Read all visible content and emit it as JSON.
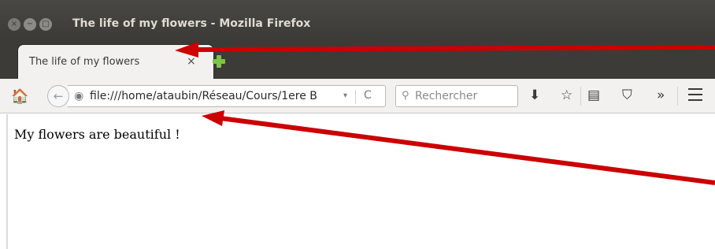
{
  "window": {
    "title": "The life of my flowers - Mozilla Firefox",
    "close_glyph": "×",
    "minimize_glyph": "−",
    "maximize_glyph": "□"
  },
  "tabs": [
    {
      "label": "The life of my flowers",
      "close_glyph": "×",
      "active": true
    }
  ],
  "navbar": {
    "home_glyph": "🏠",
    "back_glyph": "←",
    "site_icon_glyph": "◉",
    "url": "file:///home/ataubin/Réseau/Cours/1ere B",
    "dropdown_glyph": "▾",
    "reload_glyph": "C",
    "search_placeholder": "Rechercher",
    "search_icon_glyph": "⚲",
    "download_glyph": "⬇",
    "bookmark_glyph": "☆",
    "reading_list_glyph": "▤",
    "pocket_glyph": "⛉",
    "overflow_glyph": "»"
  },
  "page": {
    "text": "My flowers are beautiful !"
  },
  "colors": {
    "titlebar": "#3c3b37",
    "tab_background": "#f2f1f0",
    "newtab_plus": "#7ec447",
    "annotation_arrow": "#cc0000"
  }
}
